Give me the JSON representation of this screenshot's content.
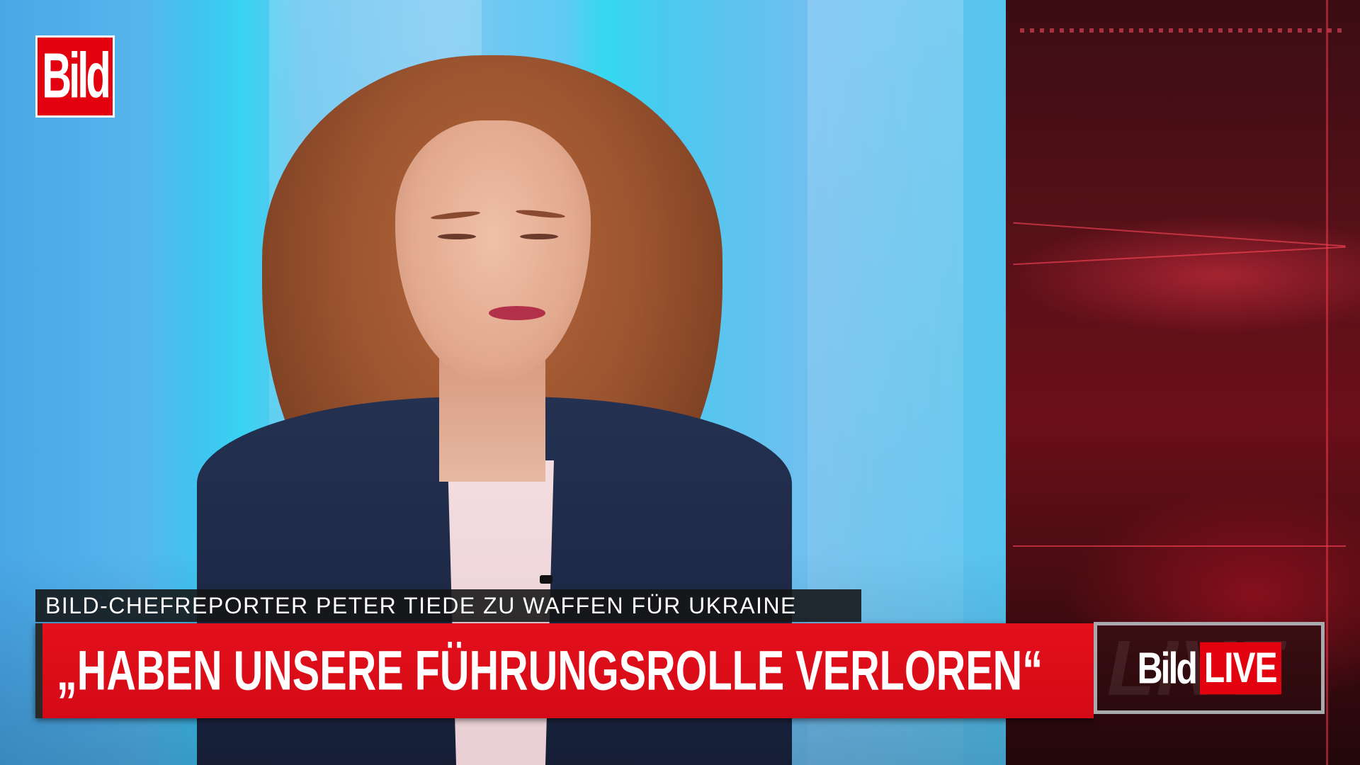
{
  "broadcast": {
    "channel_logo_text": "Bild",
    "topic_line": "BILD-CHEFREPORTER PETER TIEDE ZU WAFFEN FÜR UKRAINE",
    "headline": "„HABEN UNSERE FÜHRUNGSROLLE VERLOREN“",
    "live_bug": {
      "brand": "Bild",
      "label": "LIVE"
    }
  },
  "colors": {
    "brand_red": "#e3000f",
    "headline_bar": "#d30a16",
    "topic_bar": "#141416",
    "studio_blue": "#5fc4ef",
    "studio_red": "#6b0f19"
  },
  "icons": {
    "logo": "bild-logo-icon",
    "live": "bild-live-icon"
  }
}
